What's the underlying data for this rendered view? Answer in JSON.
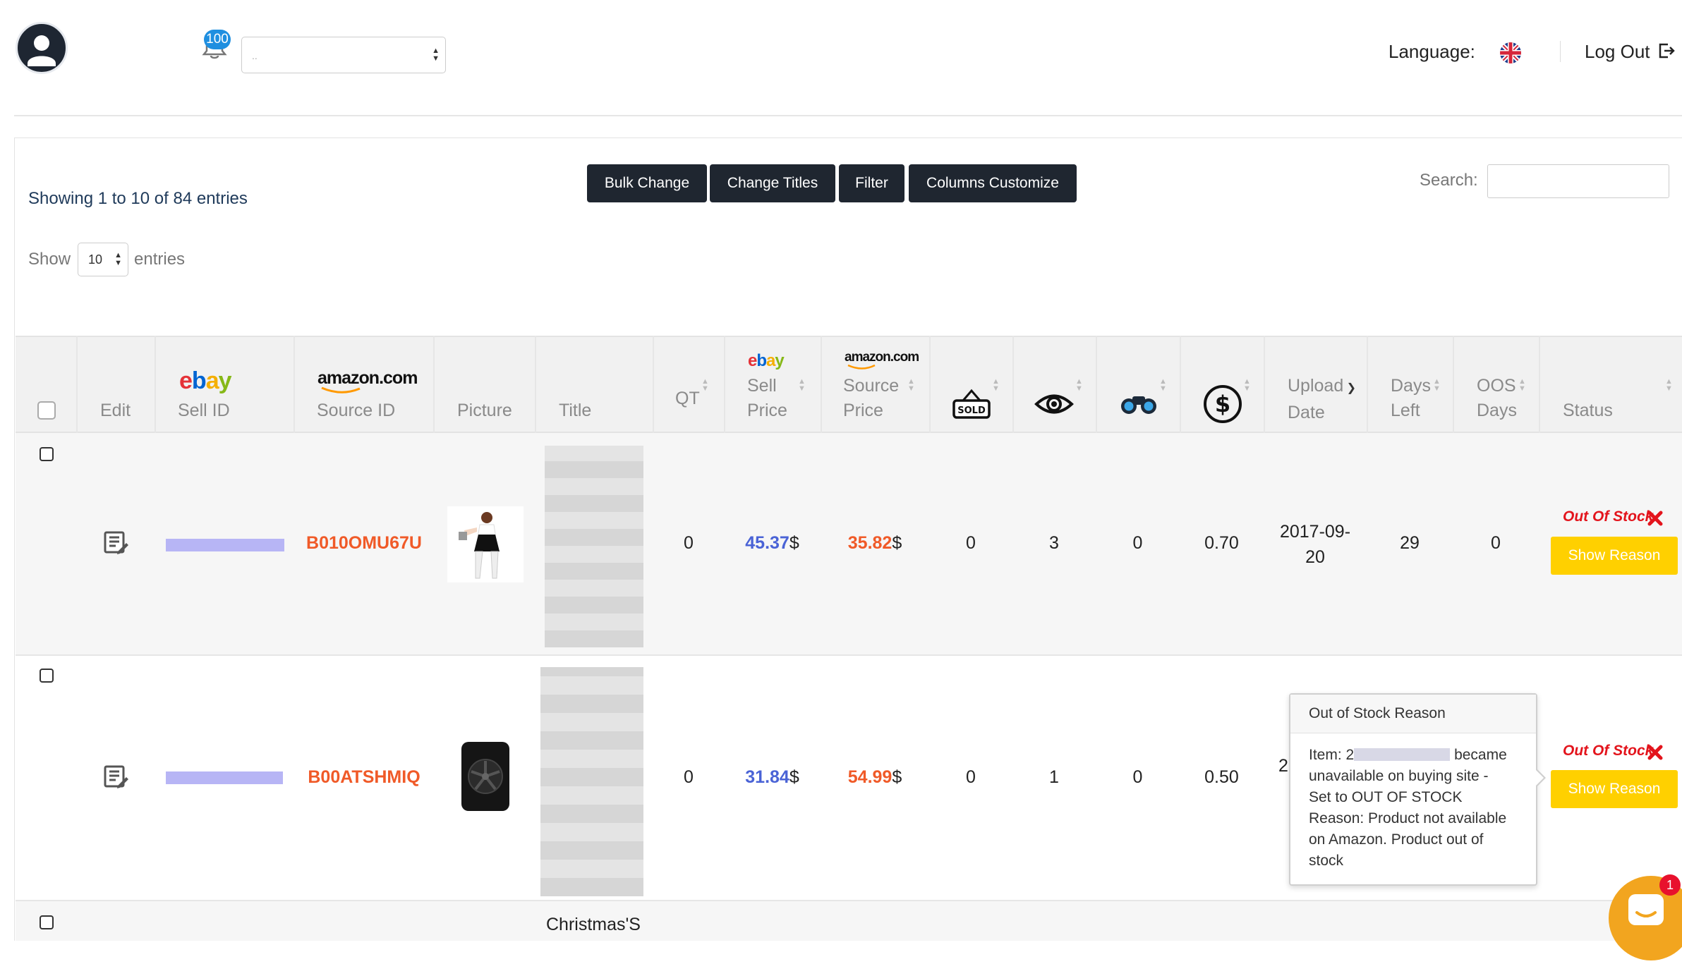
{
  "header": {
    "notification_count": "100",
    "select_placeholder": "..",
    "language_label": "Language:",
    "logout_label": "Log Out"
  },
  "toolbar": {
    "bulk_change": "Bulk Change",
    "change_titles": "Change Titles",
    "filter": "Filter",
    "columns_customize": "Columns Customize"
  },
  "info": {
    "showing": "Showing 1 to 10 of 84 entries",
    "search_label": "Search:",
    "show_label": "Show",
    "page_length": "10",
    "entries_label": "entries"
  },
  "columns": {
    "edit": "Edit",
    "sell_id_1": "Sell ID",
    "source_id": "Source ID",
    "picture": "Picture",
    "title": "Title",
    "qt": "QT",
    "sell_1": "Sell",
    "sell_2": "Price",
    "source_1": "Source",
    "source_2": "Price",
    "upload_1": "Upload",
    "upload_2": "Date",
    "days_1": "Days",
    "days_2": "Left",
    "oos_1": "OOS",
    "oos_2": "Days",
    "status": "Status",
    "sold_icon_text": "SOLD",
    "ebay_logo": "ebay",
    "amazon_logo": "amazon.com"
  },
  "rows": [
    {
      "source_id": "B010OMU67U",
      "qt": "0",
      "sell_price": "45.37",
      "source_price": "35.82",
      "currency": "$",
      "sold": "0",
      "watchers": "3",
      "views": "0",
      "profit": "0.70",
      "upload_date_1": "2017-09-",
      "upload_date_2": "20",
      "days_left": "29",
      "oos_days": "0",
      "status": "Out Of Stock",
      "reason_button": "Show Reason"
    },
    {
      "source_id": "B00ATSHMIQ",
      "qt": "0",
      "sell_price": "31.84",
      "source_price": "54.99",
      "currency": "$",
      "sold": "0",
      "watchers": "1",
      "views": "0",
      "profit": "0.50",
      "upload_date_partial": "2",
      "status": "Out Of Stock",
      "reason_button": "Show Reason"
    },
    {
      "title_partial": "Christmas'S"
    }
  ],
  "popover": {
    "title": "Out of Stock Reason",
    "item_prefix": "Item:",
    "item_prefix_partial": "2",
    "line1_suffix": "became",
    "line2": "unavailable on buying site -",
    "line3": "Set to OUT OF STOCK",
    "line4": "Reason: Product not available",
    "line5": "on Amazon. Product out of",
    "line6": "stock"
  },
  "chat": {
    "badge": "1"
  },
  "colors": {
    "dark_button": "#1f2630",
    "ebay_blue": "#4a63d6",
    "amazon_orange": "#f05a28",
    "out_of_stock_red": "#e3141c",
    "reason_yellow": "#ffd000",
    "badge_blue": "#1f8fe0"
  }
}
